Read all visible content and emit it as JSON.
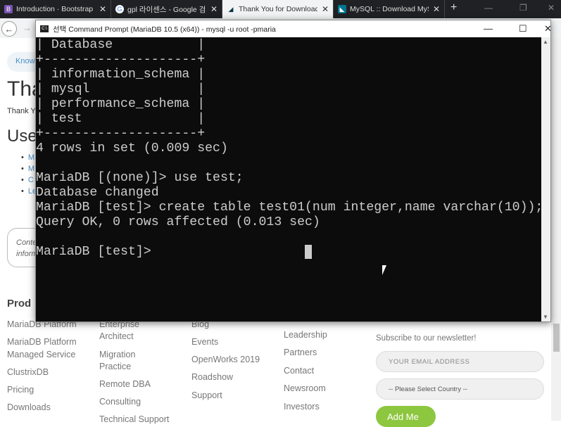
{
  "browser": {
    "tabs": [
      {
        "label": "Introduction · Bootstrap v",
        "icon": "B",
        "icon_color": "#7952b3"
      },
      {
        "label": "gpl 라이센스 - Google 검",
        "icon": "G",
        "icon_color": "#4285f4"
      },
      {
        "label": "Thank You for Downloadi",
        "icon": "mariadb-seal",
        "active": true
      },
      {
        "label": "MySQL :: Download MySC",
        "icon": "mysql-dolphin"
      }
    ],
    "new_tab": "+"
  },
  "page": {
    "pill": "Know",
    "title": "Tha",
    "lead": "Thank Y",
    "subtitle": "Use",
    "list": [
      "M",
      "M",
      "C",
      "Le"
    ],
    "note": [
      "Conte",
      "inform"
    ],
    "products_heading": "Prod",
    "footer": {
      "col1": [
        "MariaDB Platform",
        "MariaDB Platform",
        "Managed Service",
        "ClustrixDB",
        "Pricing",
        "Downloads"
      ],
      "col2": [
        "Enterprise",
        "Architect",
        "Migration",
        "Practice",
        "Remote DBA",
        "Consulting",
        "Technical Support"
      ],
      "col3": [
        "Blog",
        "Events",
        "OpenWorks 2019",
        "Roadshow",
        "Support"
      ],
      "col4": [
        "Leadership",
        "Partners",
        "Contact",
        "Newsroom",
        "Investors"
      ],
      "newsletter": "Subscribe to our newsletter!",
      "email_placeholder": "YOUR EMAIL ADDRESS",
      "country": "-- Please Select Country --",
      "add_me": "Add Me"
    }
  },
  "console": {
    "title": "선택 Command Prompt (MariaDB 10.5 (x64)) - mysql  -u root -pmaria",
    "lines": [
      "| Database           |",
      "+--------------------+",
      "| information_schema |",
      "| mysql              |",
      "| performance_schema |",
      "| test               |",
      "+--------------------+",
      "4 rows in set (0.009 sec)",
      "",
      "MariaDB [(none)]> use test;",
      "Database changed",
      "MariaDB [test]> create table test01(num integer,name varchar(10));",
      "Query OK, 0 rows affected (0.013 sec)",
      "",
      "MariaDB [test]>"
    ]
  }
}
